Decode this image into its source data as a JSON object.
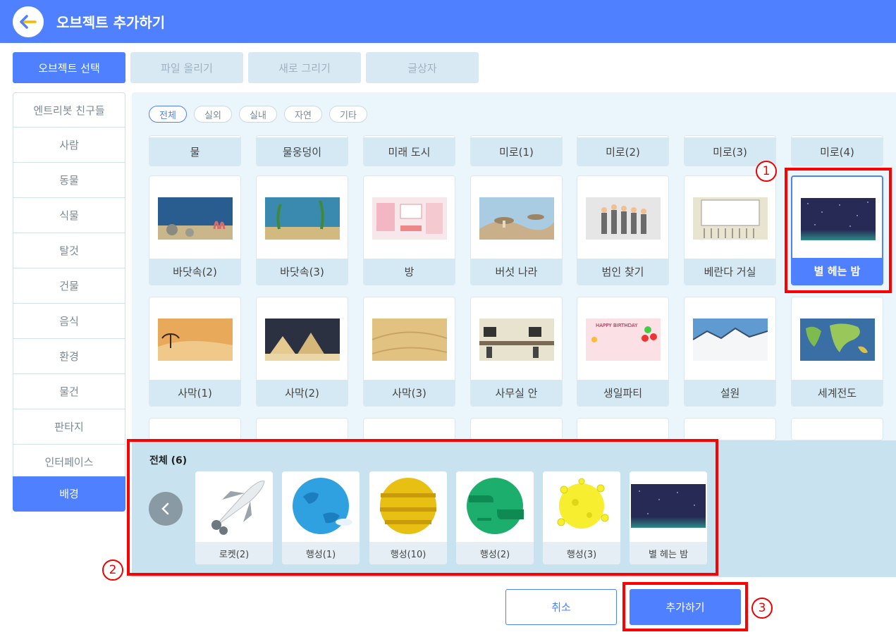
{
  "header": {
    "title": "오브젝트 추가하기",
    "accent": "#4f80ff"
  },
  "tabs": [
    {
      "label": "오브젝트 선택"
    },
    {
      "label": "파일 올리기"
    },
    {
      "label": "새로 그리기"
    },
    {
      "label": "글상자"
    }
  ],
  "categories": [
    {
      "label": "엔트리봇 친구들"
    },
    {
      "label": "사람"
    },
    {
      "label": "동물"
    },
    {
      "label": "식물"
    },
    {
      "label": "탈것"
    },
    {
      "label": "건물"
    },
    {
      "label": "음식"
    },
    {
      "label": "환경"
    },
    {
      "label": "물건"
    },
    {
      "label": "판타지"
    },
    {
      "label": "인터페이스"
    },
    {
      "label": "배경"
    }
  ],
  "filters": [
    {
      "label": "전체"
    },
    {
      "label": "실외"
    },
    {
      "label": "실내"
    },
    {
      "label": "자연"
    },
    {
      "label": "기타"
    }
  ],
  "grid": {
    "row0": [
      "물",
      "물웅덩이",
      "미래 도시",
      "미로(1)",
      "미로(2)",
      "미로(3)",
      "미로(4)"
    ],
    "row1": [
      "바닷속(2)",
      "바닷속(3)",
      "방",
      "버섯 나라",
      "범인 찾기",
      "베란다 거실",
      "별 헤는 밤"
    ],
    "row2": [
      "사막(1)",
      "사막(2)",
      "사막(3)",
      "사무실 안",
      "생일파티",
      "설원",
      "세계전도"
    ]
  },
  "tray": {
    "title": "전체 (6)",
    "items": [
      {
        "label": "로켓(2)"
      },
      {
        "label": "행성(1)"
      },
      {
        "label": "행성(10)"
      },
      {
        "label": "행성(2)"
      },
      {
        "label": "행성(3)"
      },
      {
        "label": "별 헤는 밤"
      }
    ]
  },
  "birthday_text": "HAPPY BIRTHDAY",
  "buttons": {
    "cancel": "취소",
    "add": "추가하기"
  },
  "markers": [
    "1",
    "2",
    "3"
  ]
}
